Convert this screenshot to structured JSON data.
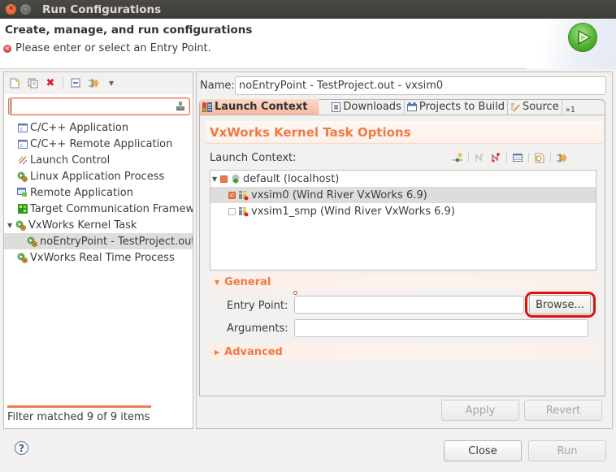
{
  "window": {
    "title": "Run Configurations",
    "close_icon": "close-icon",
    "minimize_icon": "minimize-icon"
  },
  "header": {
    "title": "Create, manage, and run configurations",
    "message": "Please enter or select an Entry Point.",
    "message_icon": "error-icon",
    "banner_icon": "run-icon"
  },
  "left_panel": {
    "toolbar": [
      {
        "name": "new-launch-configuration",
        "icon": "new-icon"
      },
      {
        "name": "duplicate",
        "icon": "duplicate-icon"
      },
      {
        "name": "delete",
        "icon": "delete-icon"
      },
      {
        "name": "collapse-all",
        "icon": "collapse-all-icon"
      },
      {
        "name": "filter",
        "icon": "filter-icon"
      },
      {
        "name": "view-menu",
        "icon": "dropdown-icon"
      }
    ],
    "filter": {
      "value": "",
      "placeholder": ""
    },
    "tree": [
      {
        "label": "C/C++ Application",
        "icon": "c-app-icon",
        "level": 0
      },
      {
        "label": "C/C++ Remote Application",
        "icon": "c-app-icon",
        "level": 0
      },
      {
        "label": "Launch Control",
        "icon": "launch-control-icon",
        "level": 0
      },
      {
        "label": "Linux Application Process",
        "icon": "process-icon",
        "level": 0
      },
      {
        "label": "Remote Application",
        "icon": "remote-app-icon",
        "level": 0
      },
      {
        "label": "Target Communication Framew",
        "icon": "tcf-icon",
        "level": 0
      },
      {
        "label": "VxWorks Kernel Task",
        "icon": "process-icon",
        "level": 0,
        "expanded": true
      },
      {
        "label": "noEntryPoint - TestProject.out",
        "icon": "process-icon",
        "level": 1,
        "selected": true
      },
      {
        "label": "VxWorks Real Time Process",
        "icon": "process-icon",
        "level": 0
      }
    ],
    "status": "Filter matched 9 of 9 items"
  },
  "right_panel": {
    "name_label": "Name:",
    "name_value": "noEntryPoint - TestProject.out - vxsim0",
    "tabs": [
      {
        "label": "Launch Context",
        "icon": "launch-context-icon",
        "active": true
      },
      {
        "label": "Downloads",
        "icon": "downloads-icon"
      },
      {
        "label": "Projects to Build",
        "icon": "projects-icon"
      },
      {
        "label": "Source",
        "icon": "source-icon"
      }
    ],
    "tabs_overflow": "»1",
    "section_title": "VxWorks Kernel Task Options",
    "launch_context_label": "Launch Context:",
    "launch_context_toolbar": [
      "new-connection-icon",
      "connect-icon",
      "disconnect-icon",
      "properties-icon",
      "refresh-icon",
      "filter-icon"
    ],
    "launch_context_tree": [
      {
        "label": "default (localhost)",
        "icon": "registry-icon",
        "level": 0,
        "check": "partial",
        "expanded": true
      },
      {
        "label": "vxsim0 (Wind River VxWorks 6.9)",
        "icon": "target-icon",
        "level": 1,
        "check": "checked",
        "selected": true
      },
      {
        "label": "vxsim1_smp (Wind River VxWorks 6.9)",
        "icon": "target-icon",
        "level": 1,
        "check": "unchecked"
      }
    ],
    "general_section": {
      "title": "General",
      "entry_point_label": "Entry Point:",
      "entry_point_value": "",
      "browse_label": "Browse...",
      "arguments_label": "Arguments:",
      "arguments_value": ""
    },
    "advanced_section": {
      "title": "Advanced"
    },
    "apply_label": "Apply",
    "revert_label": "Revert"
  },
  "footer": {
    "help_icon": "help-icon",
    "close_label": "Close",
    "run_label": "Run"
  },
  "colors": {
    "accent": "#ee7a48",
    "highlight_ring": "#e01010",
    "selection": "#dedddb"
  }
}
